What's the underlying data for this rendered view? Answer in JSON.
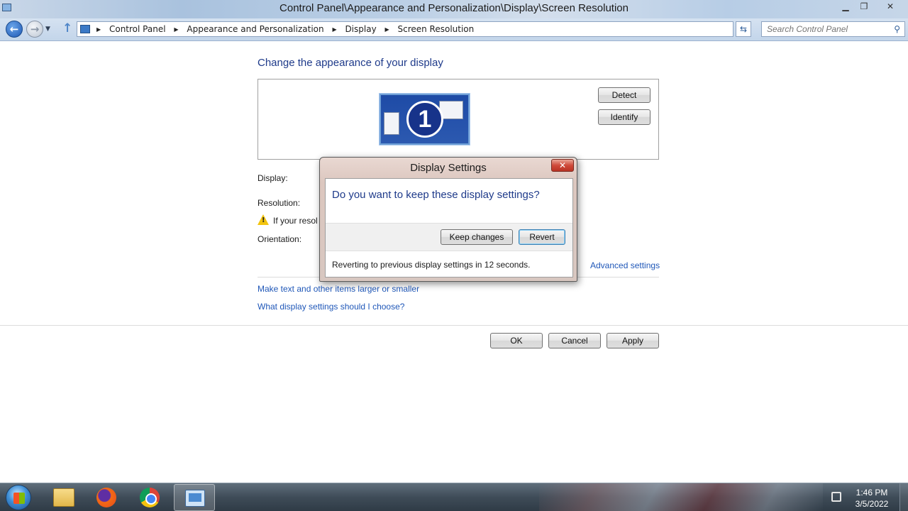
{
  "window": {
    "title": "Control Panel\\Appearance and Personalization\\Display\\Screen Resolution",
    "minimize": "▁",
    "maximize": "❐",
    "close": "✕"
  },
  "nav": {
    "back": "←",
    "forward": "→",
    "recent": "▼",
    "up": "↑",
    "breadcrumbs": [
      "Control Panel",
      "Appearance and Personalization",
      "Display",
      "Screen Resolution"
    ],
    "crumb_separator": "▶",
    "dropdown": "▼",
    "refresh": "⇆",
    "search_placeholder": "Search Control Panel",
    "search_glyph": "⚲"
  },
  "content": {
    "heading": "Change the appearance of your display",
    "monitor_number": "1",
    "detect_label": "Detect",
    "identify_label": "Identify",
    "display_label": "Display:",
    "resolution_label": "Resolution:",
    "warning_text": "If your resol",
    "warning_mark": "!",
    "orientation_label": "Orientation:",
    "advanced_link": "Advanced settings",
    "link_text_size": "Make text and other items larger or smaller",
    "link_what_settings": "What display settings should I choose?",
    "ok_label": "OK",
    "cancel_label": "Cancel",
    "apply_label": "Apply"
  },
  "dialog": {
    "title": "Display Settings",
    "close": "✕",
    "question": "Do you want to keep these display settings?",
    "keep_label": "Keep changes",
    "revert_label": "Revert",
    "footer": "Reverting to previous display settings in 12 seconds."
  },
  "taskbar": {
    "time": "1:46 PM",
    "date": "3/5/2022",
    "items": [
      "file-explorer",
      "firefox",
      "chrome",
      "control-panel"
    ]
  }
}
